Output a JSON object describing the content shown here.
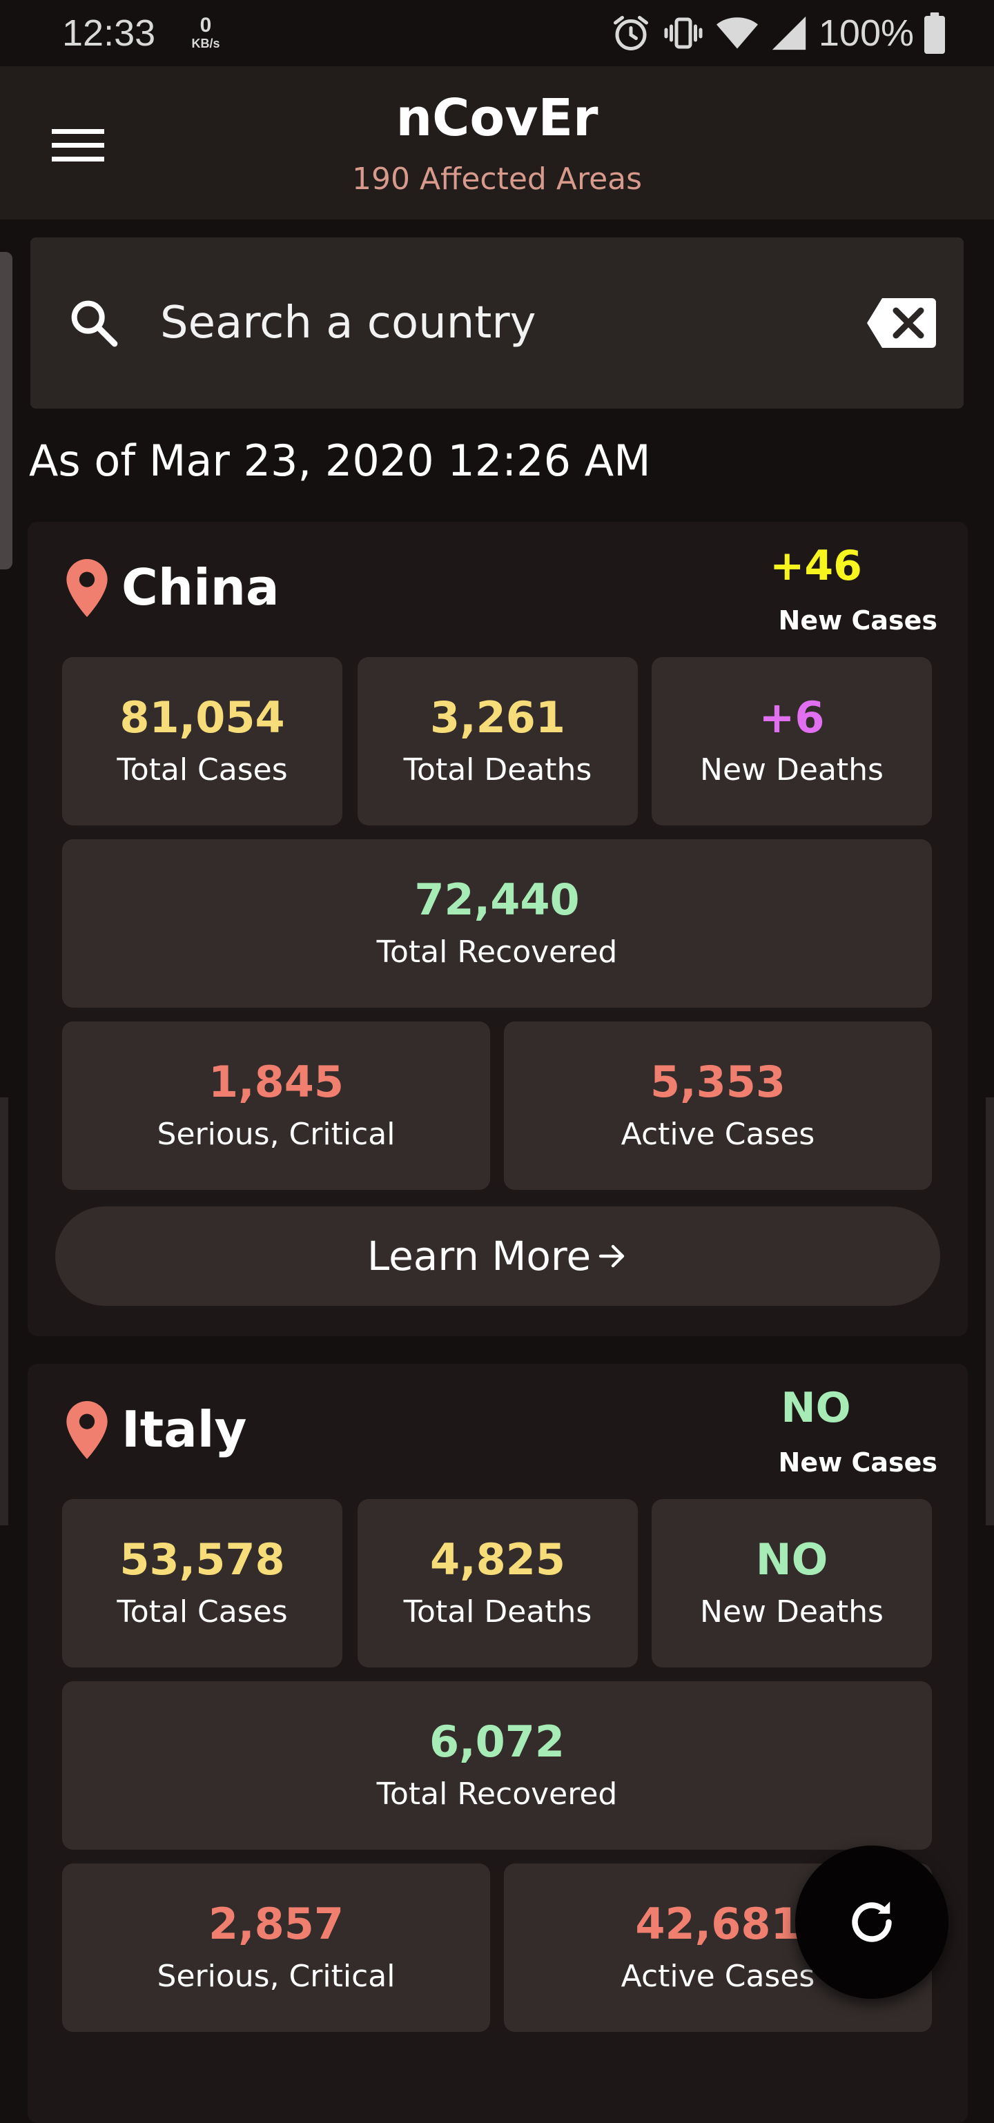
{
  "status_bar": {
    "time": "12:33",
    "net_speed_value": "0",
    "net_speed_unit": "KB/s",
    "battery": "100%",
    "icons": [
      "alarm-icon",
      "vibrate-icon",
      "wifi-icon",
      "cell-signal-icon",
      "battery-icon"
    ]
  },
  "header": {
    "title": "nCovEr",
    "subtitle": "190 Affected Areas",
    "menu_icon": "hamburger-menu-icon"
  },
  "search": {
    "placeholder": "Search a country",
    "value": ""
  },
  "as_of": "As of Mar 23, 2020 12:26 AM",
  "countries": [
    {
      "name": "China",
      "new_cases": "+46",
      "new_cases_label": "New Cases",
      "total_cases": "81,054",
      "total_cases_label": "Total Cases",
      "total_deaths": "3,261",
      "total_deaths_label": "Total Deaths",
      "new_deaths": "+6",
      "new_deaths_label": "New Deaths",
      "total_recovered": "72,440",
      "total_recovered_label": "Total Recovered",
      "serious": "1,845",
      "serious_label": "Serious, Critical",
      "active": "5,353",
      "active_label": "Active Cases",
      "learn_more": "Learn More"
    },
    {
      "name": "Italy",
      "new_cases": "NO",
      "new_cases_label": "New Cases",
      "total_cases": "53,578",
      "total_cases_label": "Total Cases",
      "total_deaths": "4,825",
      "total_deaths_label": "Total Deaths",
      "new_deaths": "NO",
      "new_deaths_label": "New Deaths",
      "total_recovered": "6,072",
      "total_recovered_label": "Total Recovered",
      "serious": "2,857",
      "serious_label": "Serious, Critical",
      "active": "42,681",
      "active_label": "Active Cases"
    }
  ],
  "colors": {
    "background": "#141010",
    "header": "#221c1a",
    "card": "#1d1817",
    "stat_box": "#332c2b",
    "yellow": "#f7dc7a",
    "bright_yellow": "#f6f51e",
    "pink": "#e070f0",
    "green": "#a7ebb6",
    "salmon": "#f07f70",
    "pin": "#f07f70",
    "subtitle": "#d99a8e"
  }
}
